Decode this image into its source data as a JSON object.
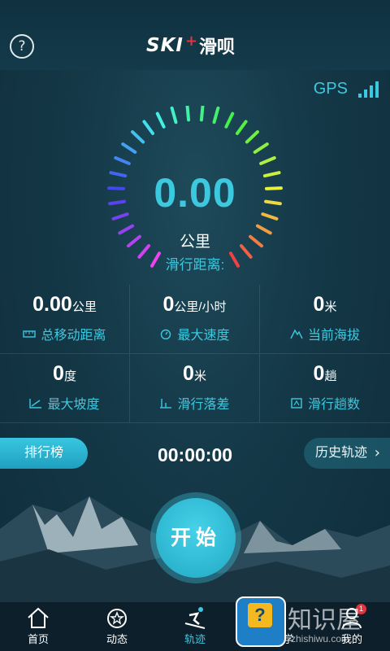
{
  "header": {
    "help_icon": "question-circle-icon",
    "logo_text": "SKI",
    "logo_plus": "+",
    "app_name": "滑呗"
  },
  "gps": {
    "label": "GPS",
    "signal_level": 4,
    "signal_max": 4
  },
  "main": {
    "distance_value": "0.00",
    "distance_unit": "公里",
    "distance_label": "滑行距离:"
  },
  "stats": [
    {
      "value": "0.00",
      "unit": "公里",
      "label": "总移动距离",
      "icon": "ruler-icon"
    },
    {
      "value": "0",
      "unit": "公里/小时",
      "label": "最大速度",
      "icon": "stopwatch-icon"
    },
    {
      "value": "0",
      "unit": "米",
      "label": "当前海拔",
      "icon": "mountain-icon"
    },
    {
      "value": "0",
      "unit": "度",
      "label": "最大坡度",
      "icon": "slope-icon"
    },
    {
      "value": "0",
      "unit": "米",
      "label": "滑行落差",
      "icon": "drop-icon"
    },
    {
      "value": "0",
      "unit": "趟",
      "label": "滑行趟数",
      "icon": "runs-icon"
    }
  ],
  "actions": {
    "ranking_label": "排行榜",
    "timer": "00:00:00",
    "history_label": "历史轨迹",
    "start_label": "开始"
  },
  "tabs": [
    {
      "label": "首页",
      "icon": "home-icon"
    },
    {
      "label": "动态",
      "icon": "star-refresh-icon"
    },
    {
      "label": "轨迹",
      "icon": "skier-icon",
      "active": true
    },
    {
      "label": "学",
      "icon": "learn-icon"
    },
    {
      "label": "我的",
      "icon": "user-icon",
      "badge": "1"
    }
  ],
  "watermark": {
    "text": "知识屋",
    "url": "zhishiwu.com"
  },
  "colors": {
    "accent": "#3cc9e0",
    "background": "#143847",
    "badge": "#e2343f"
  }
}
